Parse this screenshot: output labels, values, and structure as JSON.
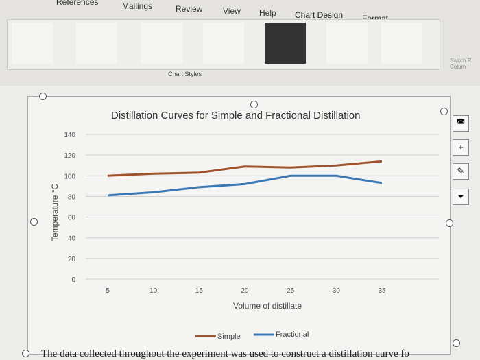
{
  "ribbon": {
    "tabs": [
      "References",
      "Mailings",
      "Review",
      "View",
      "Help",
      "Chart Design",
      "Format"
    ],
    "active_tab": "Chart Design",
    "gallery_label": "Chart Styles",
    "switch_label": "Switch R Colum"
  },
  "side_buttons": [
    "chart-styles",
    "chart-elements",
    "brush",
    "filter"
  ],
  "bottom_text": "The data collected throughout the experiment was used to construct a distillation curve fo",
  "chart_data": {
    "type": "line",
    "title": "Distillation Curves for Simple and Fractional Distillation",
    "xlabel": "Volume of distillate",
    "ylabel": "Temperature °C",
    "x": [
      5,
      10,
      15,
      20,
      25,
      30,
      35
    ],
    "ylim": [
      0,
      140
    ],
    "yticks": [
      0,
      20,
      40,
      60,
      80,
      100,
      120,
      140
    ],
    "grid": true,
    "legend": "bottom",
    "series": [
      {
        "name": "Simple",
        "color": "#a0522d",
        "values": [
          100,
          102,
          103,
          109,
          108,
          110,
          114
        ]
      },
      {
        "name": "Fractional",
        "color": "#3a78b5",
        "values": [
          81,
          84,
          89,
          92,
          100,
          100,
          93
        ]
      }
    ]
  }
}
